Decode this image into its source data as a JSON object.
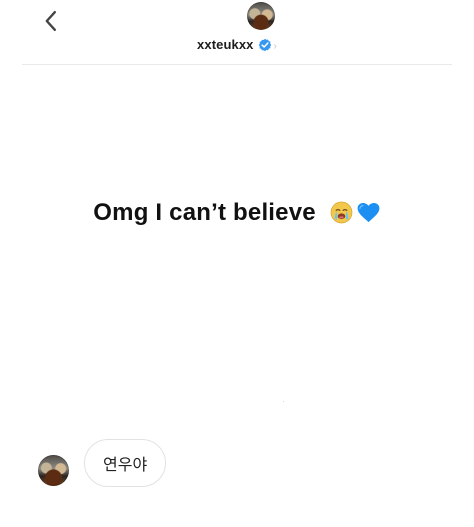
{
  "header": {
    "username": "xxteukxx",
    "verified_icon": "verified-badge-icon",
    "chevron_icon": "chevron-right-icon",
    "chevron_glyph": "›"
  },
  "story": {
    "message": "Omg I can’t believe",
    "emojis": [
      "loudly-crying-face-icon",
      "blue-heart-icon"
    ]
  },
  "reply": {
    "text": "연우야"
  },
  "colors": {
    "verified_blue": "#3897f0",
    "heart_blue": "#1d8ff2",
    "divider": "#e9e9e9"
  }
}
